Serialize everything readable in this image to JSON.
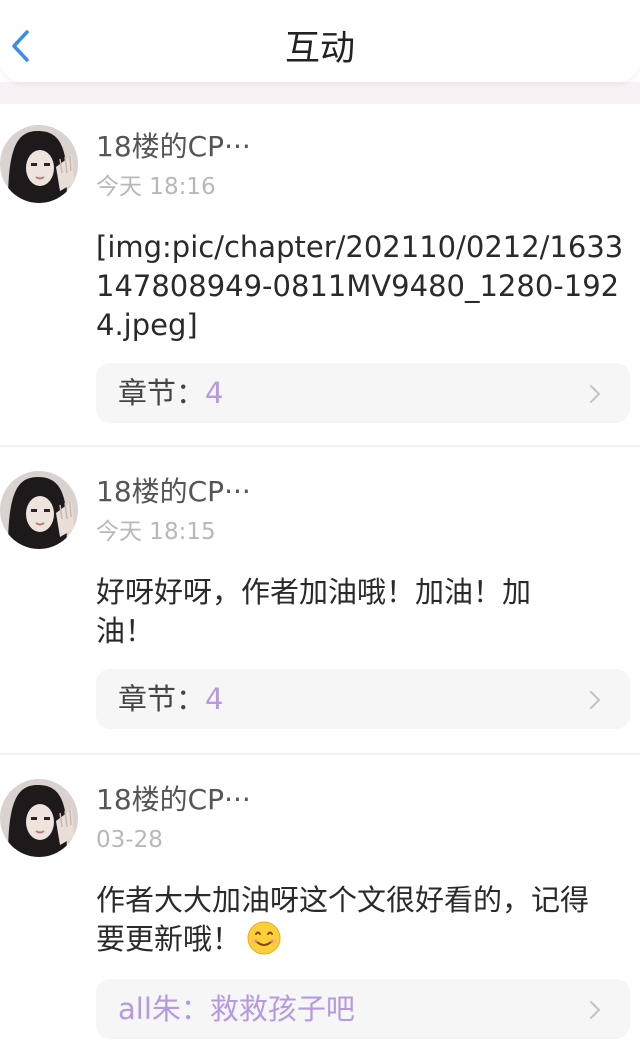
{
  "header": {
    "title": "互动",
    "back_icon": "chevron-left-icon"
  },
  "colors": {
    "accent": "#3a8ee6",
    "highlight": "#b59ae0",
    "card_ref_bg": "#f6f6f6",
    "time_gray": "#b8b8b8"
  },
  "comments": [
    {
      "username": "18楼的CP···",
      "time": "今天 18:16",
      "content": "[img:pic/chapter/202110/0212/1633147808949-0811MV9480_1280-1924.jpeg]",
      "ref_label": "章节：",
      "ref_value": "4"
    },
    {
      "username": "18楼的CP···",
      "time": "今天 18:15",
      "content": "好呀好呀，作者加油哦！加油！加油！",
      "ref_label": "章节：",
      "ref_value": "4"
    },
    {
      "username": "18楼的CP···",
      "time": "03-28",
      "content": "作者大大加油呀这个文很好看的，记得要更新哦！",
      "content_emoji": "smiling-face-icon",
      "ref_label": "",
      "ref_value": "all朱：救救孩子吧"
    }
  ]
}
